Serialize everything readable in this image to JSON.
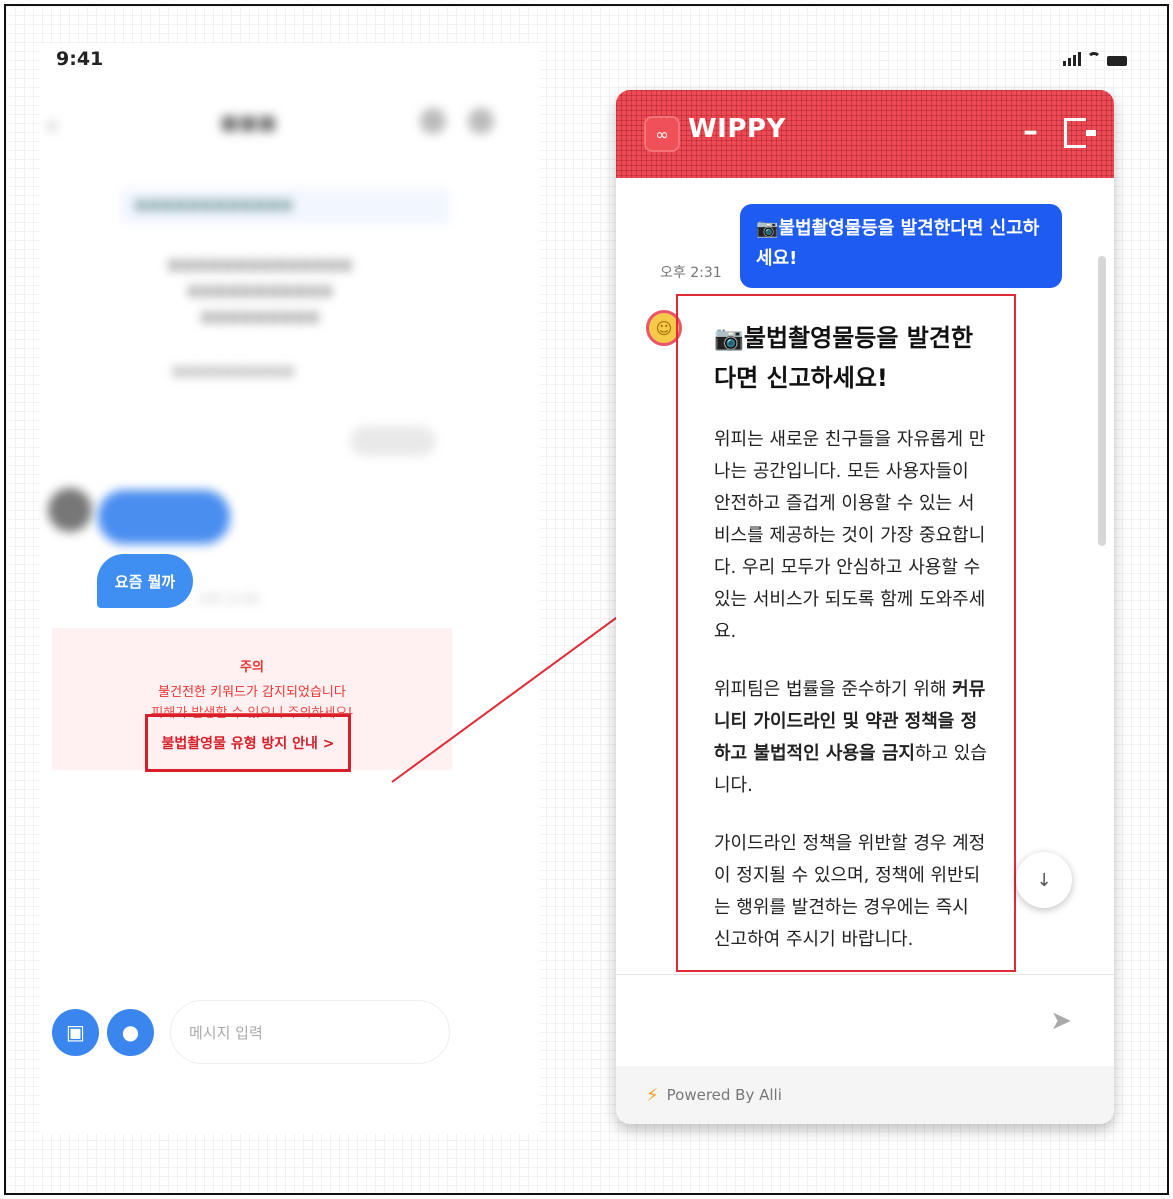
{
  "phone": {
    "time": "9:41",
    "pill_label": "요즘 뭘까",
    "pill_time": "오후 11:00",
    "warning": {
      "title": "주의",
      "line1": "불건전한 키워드가 감지되었습니다",
      "line2": "피해가 발생할 수 있으니 주의하세요!",
      "link": "불법촬영물 유형 방지 안내 >"
    },
    "input_placeholder": "메시지 입력"
  },
  "widget": {
    "brand": "WIPPY",
    "sent_message": "📷불법촬영물등을 발견한다면 신고하세요!",
    "sent_time": "오후 2:31",
    "bot_title": "📷불법촬영물등을 발견한다면 신고하세요!",
    "bot_paragraphs": [
      "위피는 새로운 친구들을 자유롭게 만나는 공간입니다. 모든 사용자들이 안전하고 즐겁게 이용할 수 있는 서비스를 제공하는 것이 가장 중요합니다. 우리 모두가 안심하고 사용할 수 있는 서비스가 되도록 함께 도와주세요."
    ],
    "bot_para2_pre": "위피팀은 법률을 준수하기 위해 ",
    "bot_para2_bold": "커뮤니티 가이드라인 및 약관 정책을 정하고 불법적인 사용을 금지",
    "bot_para2_post": "하고 있습니다.",
    "bot_para3": "가이드라인 정책을 위반할 경우 계정이 정지될 수 있으며, 정책에 위반되는 행위를 발견하는 경우에는 즉시 신고하여 주시기 바랍니다.",
    "powered_by": "Powered By Alli"
  },
  "colors": {
    "accent_red": "#ec4b55",
    "sent_blue": "#1e5bf0",
    "highlight_red": "#e12a35"
  }
}
